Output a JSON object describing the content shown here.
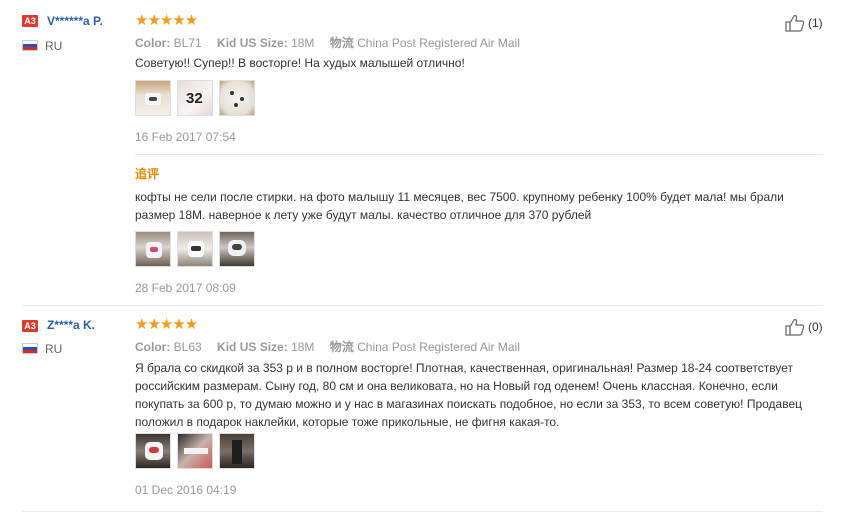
{
  "colors": {
    "accent_star": "#f39c12",
    "username": "#2a5fa8",
    "badge": "#e03a2f",
    "followup": "#e68a00"
  },
  "labels": {
    "color": "Color:",
    "size": "Kid US Size:",
    "shipping": "物流",
    "followup": "追评"
  },
  "reviews": [
    {
      "badge": "A3",
      "username": "V******a P.",
      "country": "RU",
      "stars": "★★★★★",
      "color_value": "BL71",
      "size_value": "18M",
      "shipping_value": "China Post Registered Air Mail",
      "text": "Советую!! Супер!! В восторге! На худых малышей отлично!",
      "date": "16 Feb 2017 07:54",
      "helpful_count": "(1)",
      "followup_text": "кофты не сели после стирки. на фото малышу 11 месяцев, вес 7500. крупному ребенку 100% будет мала! мы брали размер 18M. наверное к лету уже будут малы. качество отличное для 370 рублей",
      "followup_date": "28 Feb 2017 08:09"
    },
    {
      "badge": "A3",
      "username": "Z****a K.",
      "country": "RU",
      "stars": "★★★★★",
      "color_value": "BL63",
      "size_value": "18M",
      "shipping_value": "China Post Registered Air Mail",
      "text": "Я брала со скидкой за 353 р и в полном восторге! Плотная, качественная, оригинальная! Размер 18-24 соответствует российским размерам. Сыну год, 80 см и она великовата, но на Новый год оденем! Очень классная. Конечно, если покупать за 600 р, то думаю можно и у нас в магазинах поискать подобное, но если за 353, то всем советую! Продавец положил в подарок наклейки, которые тоже прикольные, не фигня какая-то.",
      "date": "01 Dec 2016 04:19",
      "helpful_count": "(0)"
    }
  ]
}
